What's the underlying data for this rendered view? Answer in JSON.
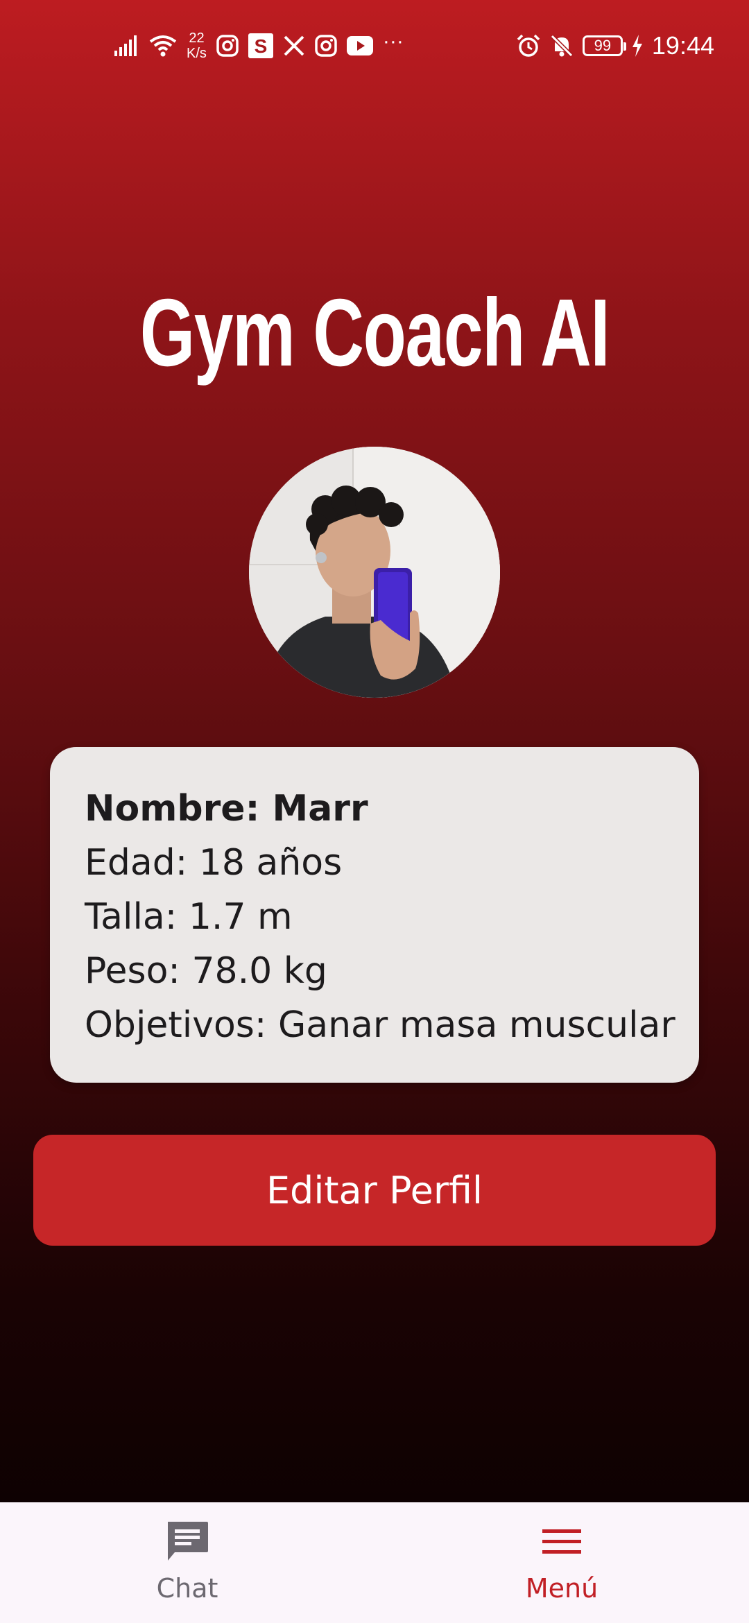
{
  "status_bar": {
    "net_speed_value": "22",
    "net_speed_unit": "K/s",
    "battery": "99",
    "time": "19:44",
    "more": "···",
    "icons": [
      "signal-icon",
      "wifi-icon",
      "instagram-icon",
      "s-app-icon",
      "x-icon",
      "instagram-icon",
      "youtube-icon",
      "alarm-icon",
      "notifications-off-icon",
      "battery-icon",
      "charging-icon"
    ]
  },
  "app": {
    "title": "Gym Coach AI"
  },
  "profile": {
    "name_line": "Nombre: Marr",
    "age_line": "Edad: 18 años",
    "height_line": "Talla: 1.7 m",
    "weight_line": "Peso: 78.0 kg",
    "goals_line": "Objetivos: Ganar masa muscular"
  },
  "actions": {
    "edit_profile_label": "Editar Perfil"
  },
  "bottom_nav": {
    "items": [
      {
        "label": "Chat",
        "icon": "chat-icon",
        "active": false
      },
      {
        "label": "Menú",
        "icon": "menu-icon",
        "active": true
      }
    ]
  },
  "colors": {
    "accent": "#c62628",
    "active_nav": "#c11f25",
    "inactive_nav": "#6c6870",
    "card_bg": "#ebe8e7",
    "gradient_top": "#bd1c21",
    "gradient_bottom": "#070000"
  }
}
